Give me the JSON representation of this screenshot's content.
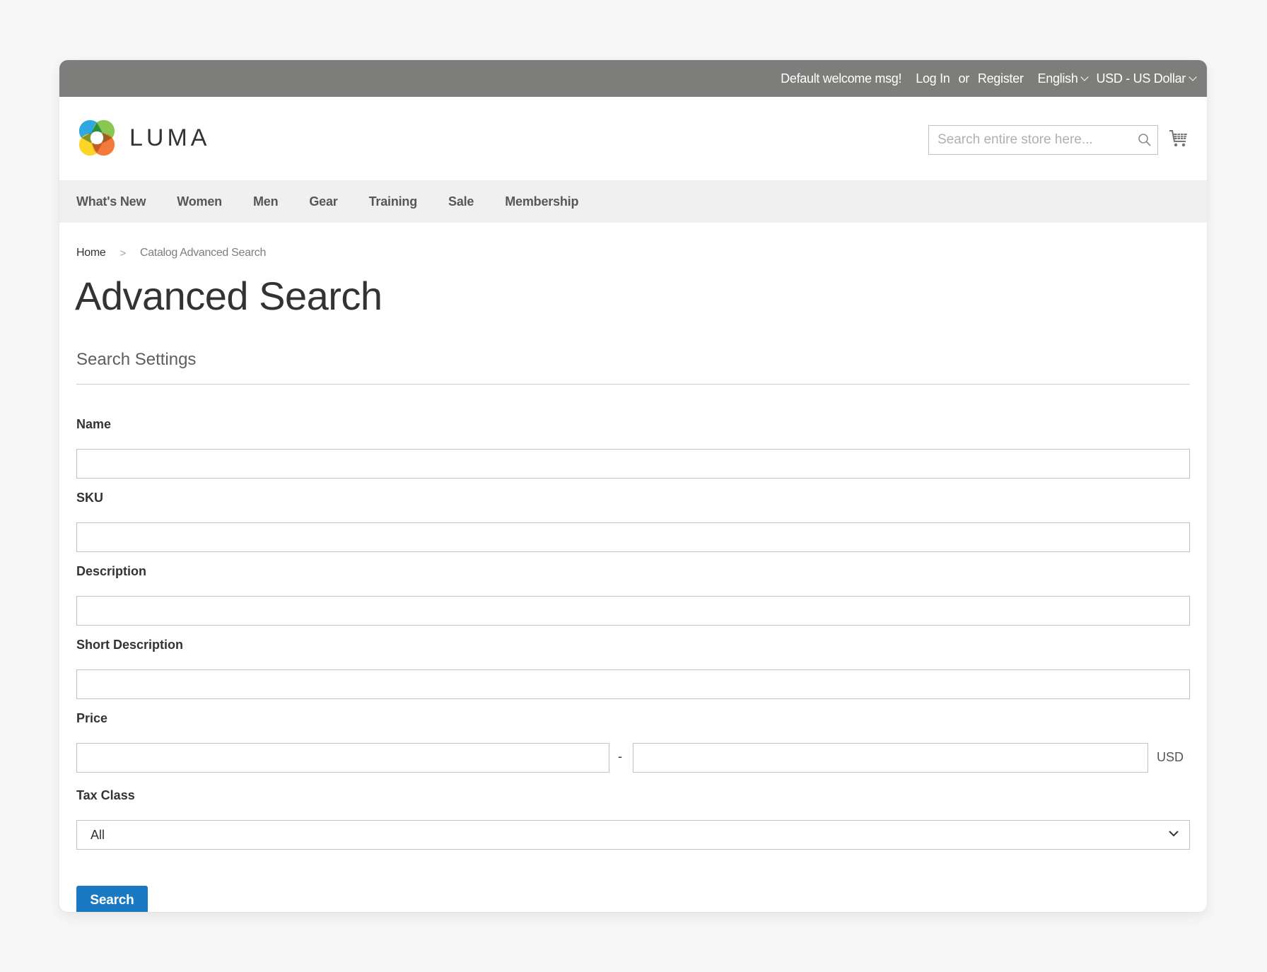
{
  "panel": {
    "welcome": "Default welcome msg!",
    "login": "Log In",
    "or": "or",
    "register": "Register",
    "language": "English",
    "currency": "USD - US Dollar"
  },
  "header": {
    "logo_text": "LUMA",
    "search_placeholder": "Search entire store here...",
    "search_value": ""
  },
  "nav": {
    "items": [
      {
        "label": "What's New"
      },
      {
        "label": "Women"
      },
      {
        "label": "Men"
      },
      {
        "label": "Gear"
      },
      {
        "label": "Training"
      },
      {
        "label": "Sale"
      },
      {
        "label": "Membership"
      }
    ]
  },
  "breadcrumbs": {
    "home": "Home",
    "separator": ">",
    "current": "Catalog Advanced Search"
  },
  "page": {
    "title": "Advanced Search",
    "legend": "Search Settings"
  },
  "form": {
    "fields": [
      {
        "label": "Name",
        "value": ""
      },
      {
        "label": "SKU",
        "value": ""
      },
      {
        "label": "Description",
        "value": ""
      },
      {
        "label": "Short Description",
        "value": ""
      }
    ],
    "price": {
      "label": "Price",
      "from_value": "",
      "to_value": "",
      "separator": "-",
      "currency": "USD"
    },
    "tax_class": {
      "label": "Tax Class",
      "selected": "All"
    },
    "submit_label": "Search"
  },
  "colors": {
    "panel_bg": "#7d7e7b",
    "nav_bg": "#f0f0f0",
    "primary_button": "#1979c3"
  }
}
